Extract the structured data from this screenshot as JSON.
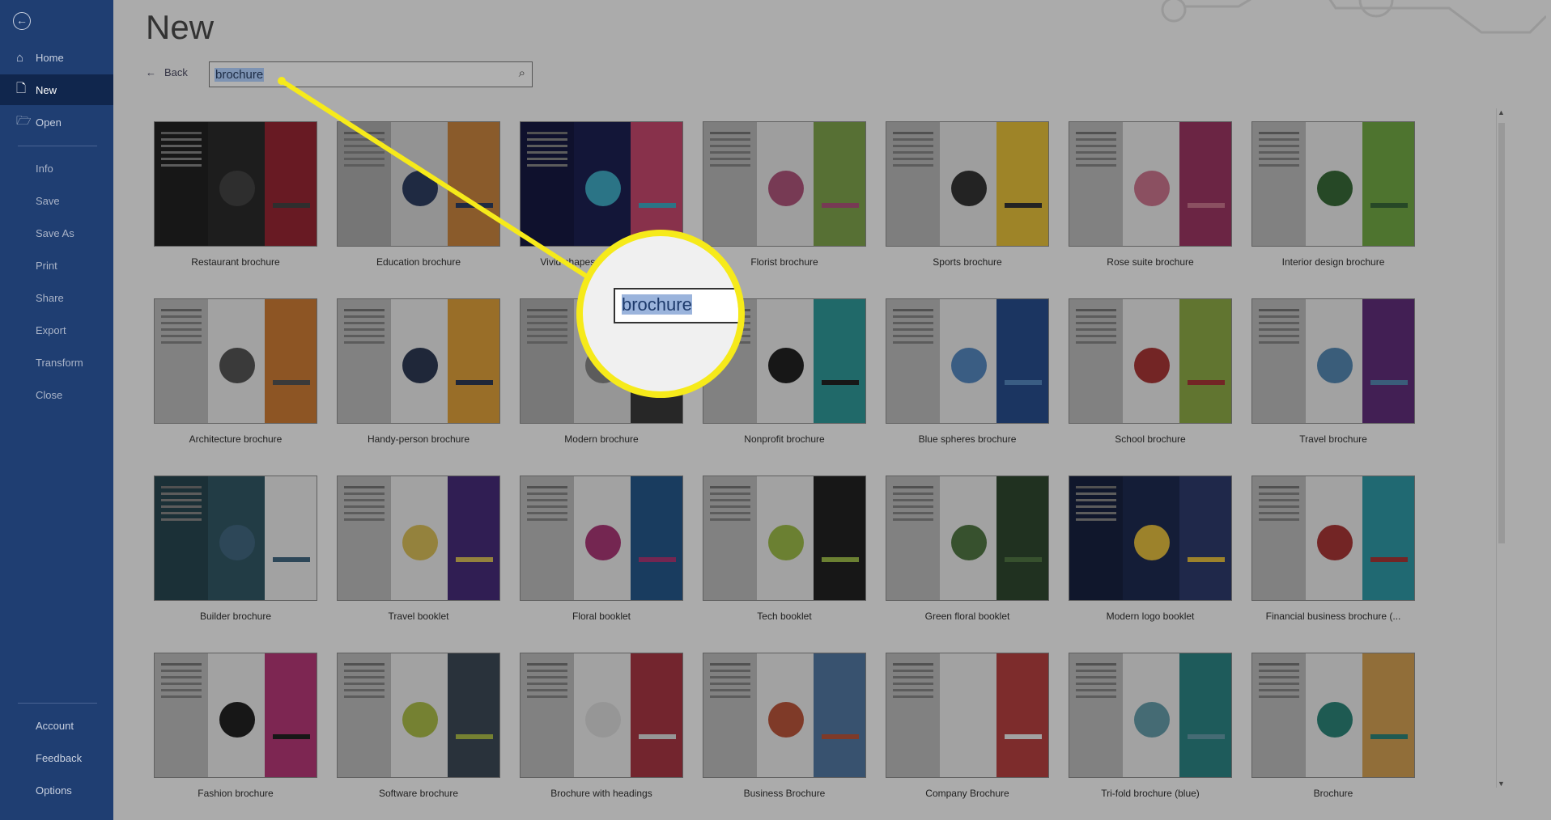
{
  "sidebar": {
    "back_icon": "back-arrow-circle-icon",
    "top": [
      {
        "label": "Home",
        "icon": "home-icon"
      },
      {
        "label": "New",
        "icon": "new-document-icon",
        "active": true
      },
      {
        "label": "Open",
        "icon": "folder-open-icon"
      }
    ],
    "middle": [
      "Info",
      "Save",
      "Save As",
      "Print",
      "Share",
      "Export",
      "Transform",
      "Close"
    ],
    "bottom": [
      "Account",
      "Feedback",
      "Options"
    ]
  },
  "header": {
    "title": "New",
    "back_label": "Back"
  },
  "search": {
    "value": "brochure",
    "icon": "search-icon"
  },
  "magnifier": {
    "text": "brochure",
    "color": "#f6ea1a"
  },
  "templates": [
    {
      "label": "Restaurant brochure",
      "colors": [
        "#2a2a2a",
        "#b02030",
        "#444"
      ]
    },
    {
      "label": "Education brochure",
      "colors": [
        "#d8d8d8",
        "#d9832c",
        "#2a3e6a"
      ]
    },
    {
      "label": "Vivid shapes event brochure",
      "colors": [
        "#1a1f5e",
        "#e04070",
        "#2ab0d0"
      ]
    },
    {
      "label": "Florist brochure",
      "colors": [
        "#e8e8e8",
        "#7aa83a",
        "#c05080"
      ]
    },
    {
      "label": "Sports brochure",
      "colors": [
        "#e8e8e8",
        "#f2c21a",
        "#333"
      ]
    },
    {
      "label": "Rose suite brochure",
      "colors": [
        "#eee",
        "#b0306a",
        "#dd7090"
      ]
    },
    {
      "label": "Interior design brochure",
      "colors": [
        "#eee",
        "#6ab030",
        "#2e6e2e"
      ]
    },
    {
      "label": "Architecture brochure",
      "colors": [
        "#eee",
        "#e07a20",
        "#555"
      ]
    },
    {
      "label": "Handy-person brochure",
      "colors": [
        "#eee",
        "#f0a020",
        "#2a3a5a"
      ]
    },
    {
      "label": "Modern brochure",
      "colors": [
        "#ddd",
        "#3a3a3a",
        "#888"
      ]
    },
    {
      "label": "Nonprofit brochure",
      "colors": [
        "#eee",
        "#1aa0a0",
        "#222"
      ]
    },
    {
      "label": "Blue spheres brochure",
      "colors": [
        "#eee",
        "#1f4fa0",
        "#4a8ad0"
      ]
    },
    {
      "label": "School brochure",
      "colors": [
        "#eee",
        "#8ab030",
        "#c03030"
      ]
    },
    {
      "label": "Travel brochure",
      "colors": [
        "#eee",
        "#6a2a8a",
        "#4a8ac0"
      ]
    },
    {
      "label": "Builder brochure",
      "colors": [
        "#2a5a6a",
        "#eee",
        "#3a6a8a"
      ]
    },
    {
      "label": "Travel booklet",
      "colors": [
        "#eee",
        "#4a2a8a",
        "#e0c040"
      ]
    },
    {
      "label": "Floral booklet",
      "colors": [
        "#eee",
        "#1a5a9a",
        "#c03080"
      ]
    },
    {
      "label": "Tech booklet",
      "colors": [
        "#eee",
        "#222",
        "#9ac030"
      ]
    },
    {
      "label": "Green floral booklet",
      "colors": [
        "#eee",
        "#2a4a2a",
        "#4a7a3a"
      ]
    },
    {
      "label": "Modern logo booklet",
      "colors": [
        "#1a2a5a",
        "#2a3a7a",
        "#f0c020"
      ]
    },
    {
      "label": "Financial business brochure (...",
      "colors": [
        "#eee",
        "#1aa0b0",
        "#c03030"
      ]
    },
    {
      "label": "Fashion brochure",
      "colors": [
        "#eee",
        "#d03080",
        "#222"
      ]
    },
    {
      "label": "Software brochure",
      "colors": [
        "#eee",
        "#3a4a5a",
        "#aac030"
      ]
    },
    {
      "label": "Brochure with headings",
      "colors": [
        "#eee",
        "#c03040",
        "#ddd"
      ]
    },
    {
      "label": "Business Brochure",
      "colors": [
        "#eee",
        "#4a7ab0",
        "#d05030"
      ]
    },
    {
      "label": "Company Brochure",
      "colors": [
        "#eee",
        "#d03a3a",
        "#eee"
      ]
    },
    {
      "label": "Tri-fold brochure (blue)",
      "colors": [
        "#eee",
        "#1a8a8a",
        "#5aa0b0"
      ]
    },
    {
      "label": "Brochure",
      "colors": [
        "#eee",
        "#e0a040",
        "#1a8a7a"
      ]
    }
  ]
}
